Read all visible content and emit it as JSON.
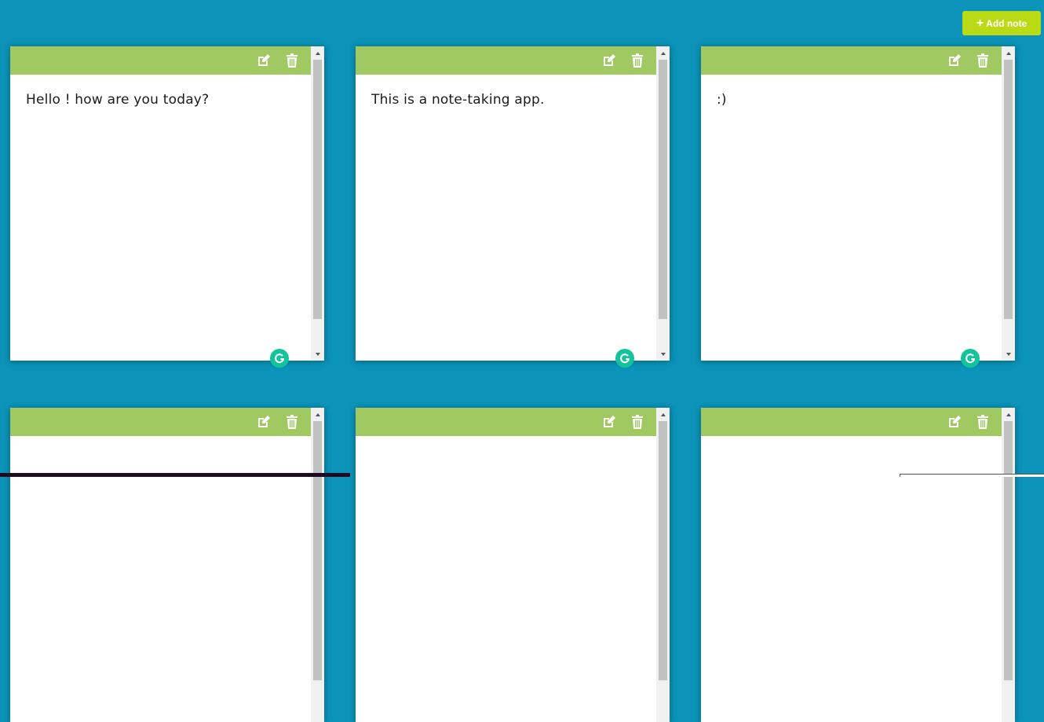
{
  "toolbar": {
    "add_note_label": "Add note",
    "add_icon": "plus-icon"
  },
  "notes": [
    {
      "text": "Hello ! how are you today?"
    },
    {
      "text": "This is a note-taking app."
    },
    {
      "text": ":)"
    },
    {
      "text": ""
    },
    {
      "text": ""
    },
    {
      "text": ""
    }
  ],
  "note_actions": {
    "edit_icon": "edit-icon",
    "delete_icon": "trash-icon"
  },
  "colors": {
    "background": "#0b93b9",
    "note_header": "#a0ca61",
    "add_button": "#b9da14",
    "grammarly_badge": "#15c39a"
  }
}
